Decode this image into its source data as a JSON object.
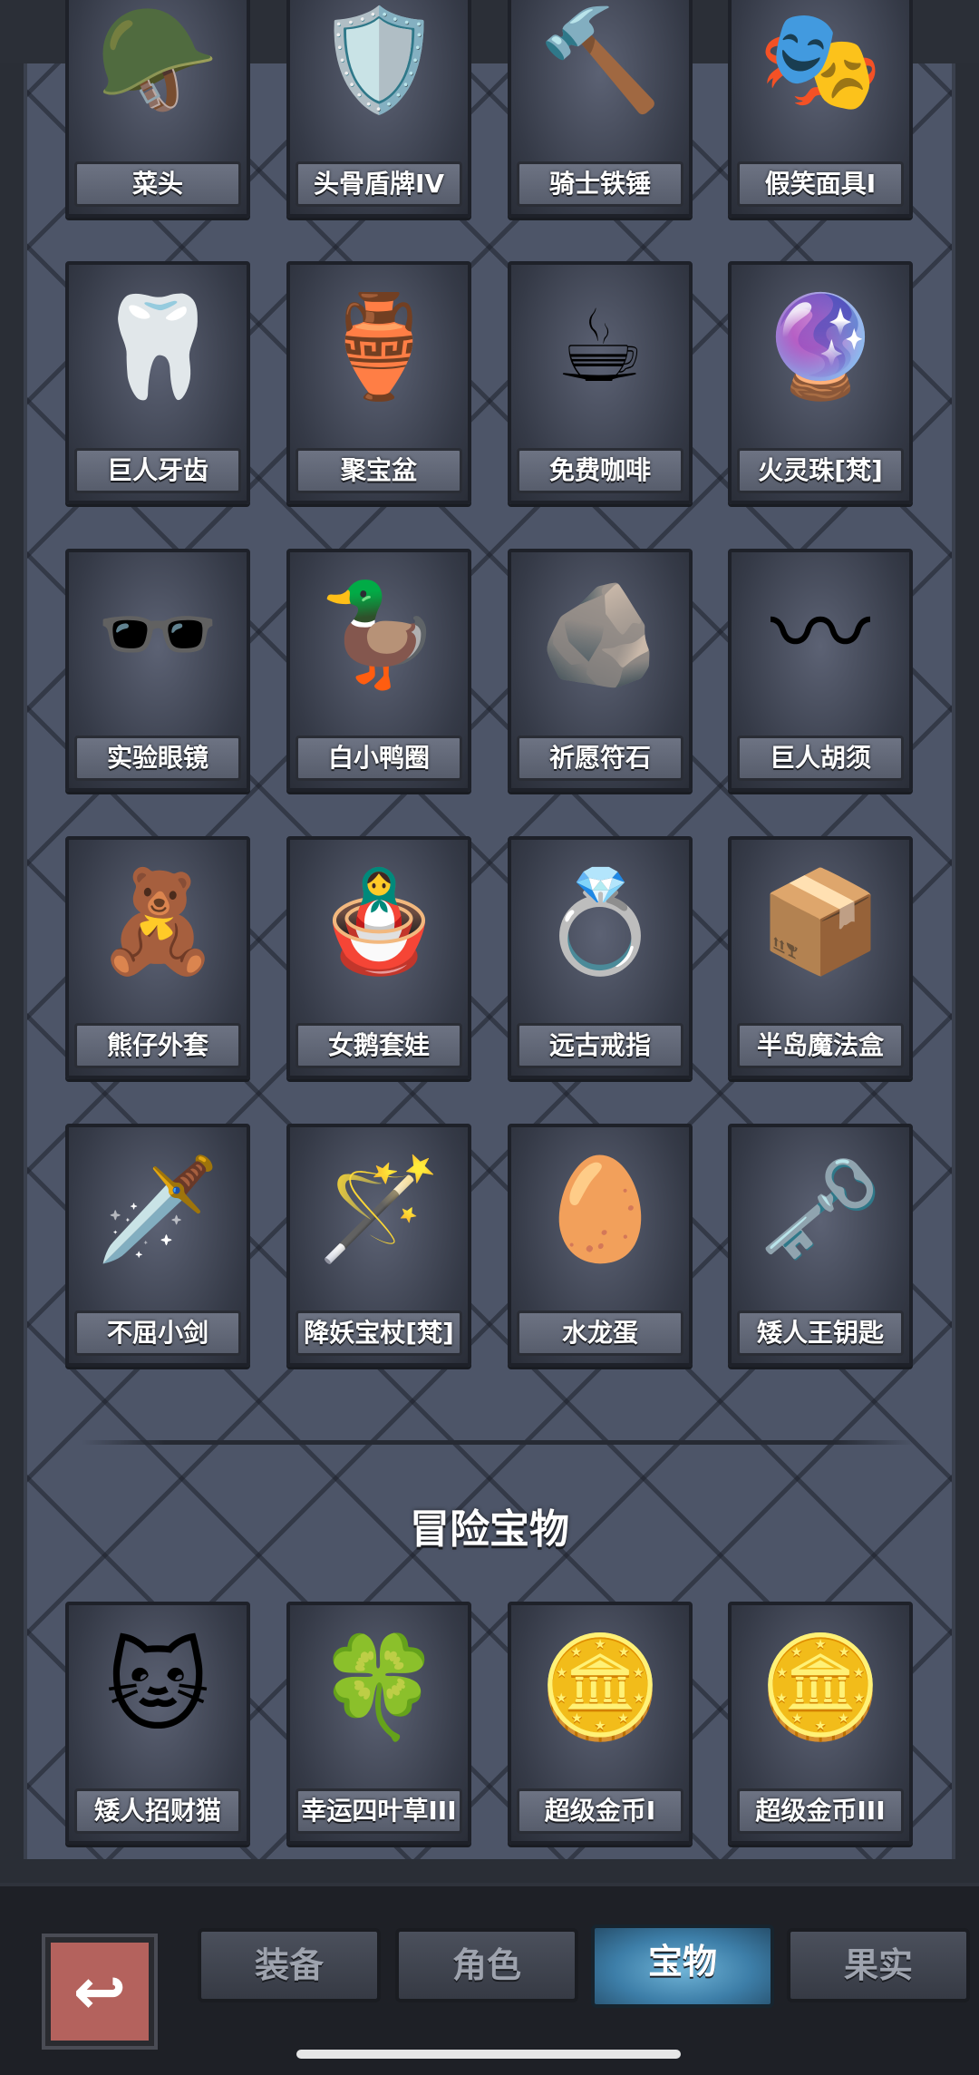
{
  "section_title": "冒险宝物",
  "items_row0": [
    {
      "name": "菜头",
      "icon": "🪖"
    },
    {
      "name": "头骨盾牌IV",
      "icon": "🛡️"
    },
    {
      "name": "骑士铁锤",
      "icon": "🔨"
    },
    {
      "name": "假笑面具I",
      "icon": "🎭"
    }
  ],
  "items_row1": [
    {
      "name": "巨人牙齿",
      "icon": "🦷"
    },
    {
      "name": "聚宝盆",
      "icon": "🏺"
    },
    {
      "name": "免费咖啡",
      "icon": "☕"
    },
    {
      "name": "火灵珠[梵]",
      "icon": "🔮"
    }
  ],
  "items_row2": [
    {
      "name": "实验眼镜",
      "icon": "🕶️"
    },
    {
      "name": "白小鸭圈",
      "icon": "🦆"
    },
    {
      "name": "祈愿符石",
      "icon": "🪨"
    },
    {
      "name": "巨人胡须",
      "icon": "〰"
    }
  ],
  "items_row3": [
    {
      "name": "熊仔外套",
      "icon": "🧸"
    },
    {
      "name": "女鹅套娃",
      "icon": "🪆"
    },
    {
      "name": "远古戒指",
      "icon": "💍"
    },
    {
      "name": "半岛魔法盒",
      "icon": "📦"
    }
  ],
  "items_row4": [
    {
      "name": "不屈小剑",
      "icon": "🗡️"
    },
    {
      "name": "降妖宝杖[梵]",
      "icon": "🪄"
    },
    {
      "name": "水龙蛋",
      "icon": "🥚"
    },
    {
      "name": "矮人王钥匙",
      "icon": "🗝️"
    }
  ],
  "adventure_items": [
    {
      "name": "矮人招财猫",
      "icon": "🐱"
    },
    {
      "name": "幸运四叶草III",
      "icon": "🍀"
    },
    {
      "name": "超级金币I",
      "icon": "🪙"
    },
    {
      "name": "超级金币III",
      "icon": "🪙"
    }
  ],
  "tabs": [
    {
      "label": "装备"
    },
    {
      "label": "角色"
    },
    {
      "label": "宝物"
    },
    {
      "label": "果实"
    }
  ],
  "active_tab": "宝物",
  "back_icon": "↩",
  "colors": {
    "panel": "#4d5568",
    "card": "#353a47",
    "label": "#5f6575",
    "active_tab": "#3d7ea8"
  }
}
